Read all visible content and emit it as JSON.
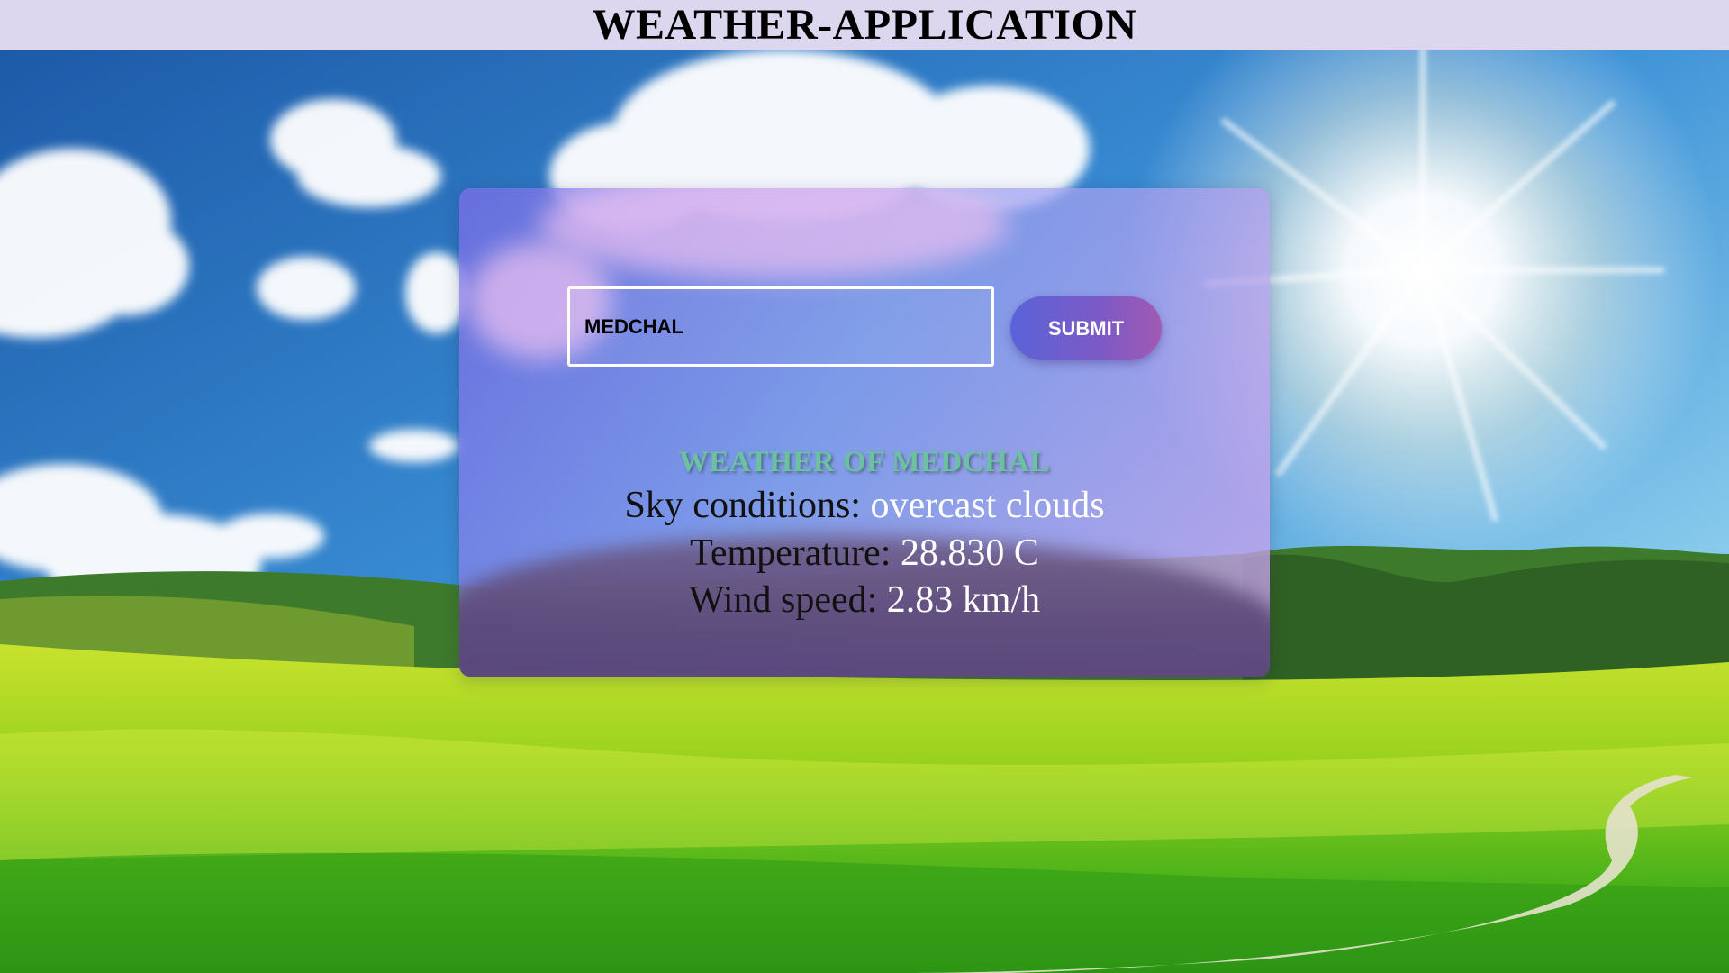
{
  "header": {
    "title": "WEATHER-APPLICATION"
  },
  "search": {
    "city_value": "MEDCHAL",
    "submit_label": "SUBMIT"
  },
  "result": {
    "title": "WEATHER OF MEDCHAL",
    "sky_label": "Sky conditions:",
    "sky_value": "overcast clouds",
    "temp_label": "Temperature:",
    "temp_value": "28.830 C",
    "wind_label": "Wind speed:",
    "wind_value": "2.83 km/h"
  },
  "colors": {
    "header_bg": "#dcd7ef",
    "title_green": "#6cc2a0",
    "button_start": "#5a63d8",
    "button_end": "#a05ab3"
  }
}
